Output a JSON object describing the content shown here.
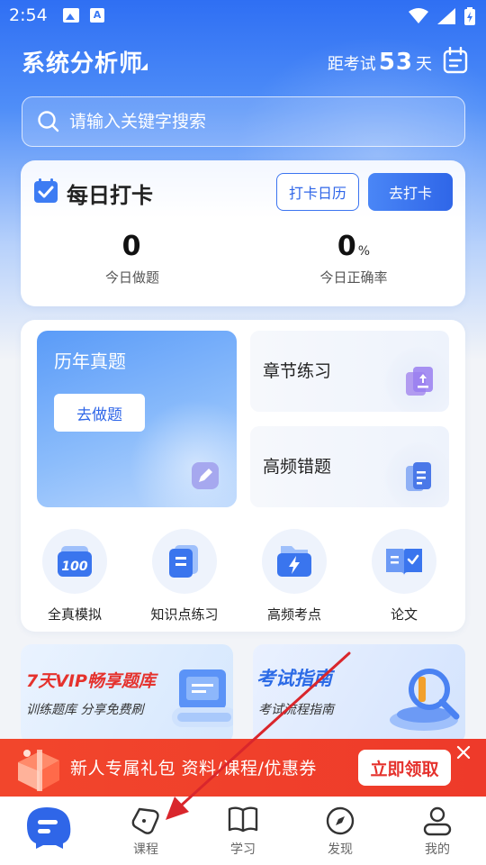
{
  "status_bar": {
    "time": "2:54"
  },
  "header": {
    "title": "系统分析师",
    "countdown_prefix": "距考试",
    "countdown_days": "53",
    "countdown_suffix": "天"
  },
  "search": {
    "placeholder": "请输入关键字搜索"
  },
  "checkin": {
    "title": "每日打卡",
    "calendar_button": "打卡日历",
    "checkin_button": "去打卡",
    "stats": [
      {
        "value": "0",
        "unit": "",
        "label": "今日做题"
      },
      {
        "value": "0",
        "unit": "%",
        "label": "今日正确率"
      }
    ]
  },
  "practice": {
    "past_papers": {
      "title": "历年真题",
      "button": "去做题"
    },
    "chapter": {
      "title": "章节练习"
    },
    "mistakes": {
      "title": "高频错题"
    },
    "quick": [
      {
        "label": "全真模拟",
        "icon": "score-100-icon"
      },
      {
        "label": "知识点练习",
        "icon": "document-list-icon"
      },
      {
        "label": "高频考点",
        "icon": "lightning-folder-icon"
      },
      {
        "label": "论文",
        "icon": "open-book-icon"
      }
    ]
  },
  "banners": {
    "vip": {
      "title": "7天VIP畅享题库",
      "subtitle": "训练题库 分享免费刷"
    },
    "guide": {
      "title": "考试指南",
      "subtitle": "考试流程指南"
    }
  },
  "gift": {
    "text": "新人专属礼包  资料/课程/优惠券",
    "button": "立即领取"
  },
  "tabs": [
    {
      "label": "",
      "icon": "home-icon"
    },
    {
      "label": "课程",
      "icon": "course-icon"
    },
    {
      "label": "学习",
      "icon": "book-icon"
    },
    {
      "label": "发现",
      "icon": "compass-icon"
    },
    {
      "label": "我的",
      "icon": "profile-icon"
    }
  ],
  "colors": {
    "primary": "#2f66e8",
    "accent_red": "#ee3a2a",
    "annotation_red": "#d9262c"
  }
}
